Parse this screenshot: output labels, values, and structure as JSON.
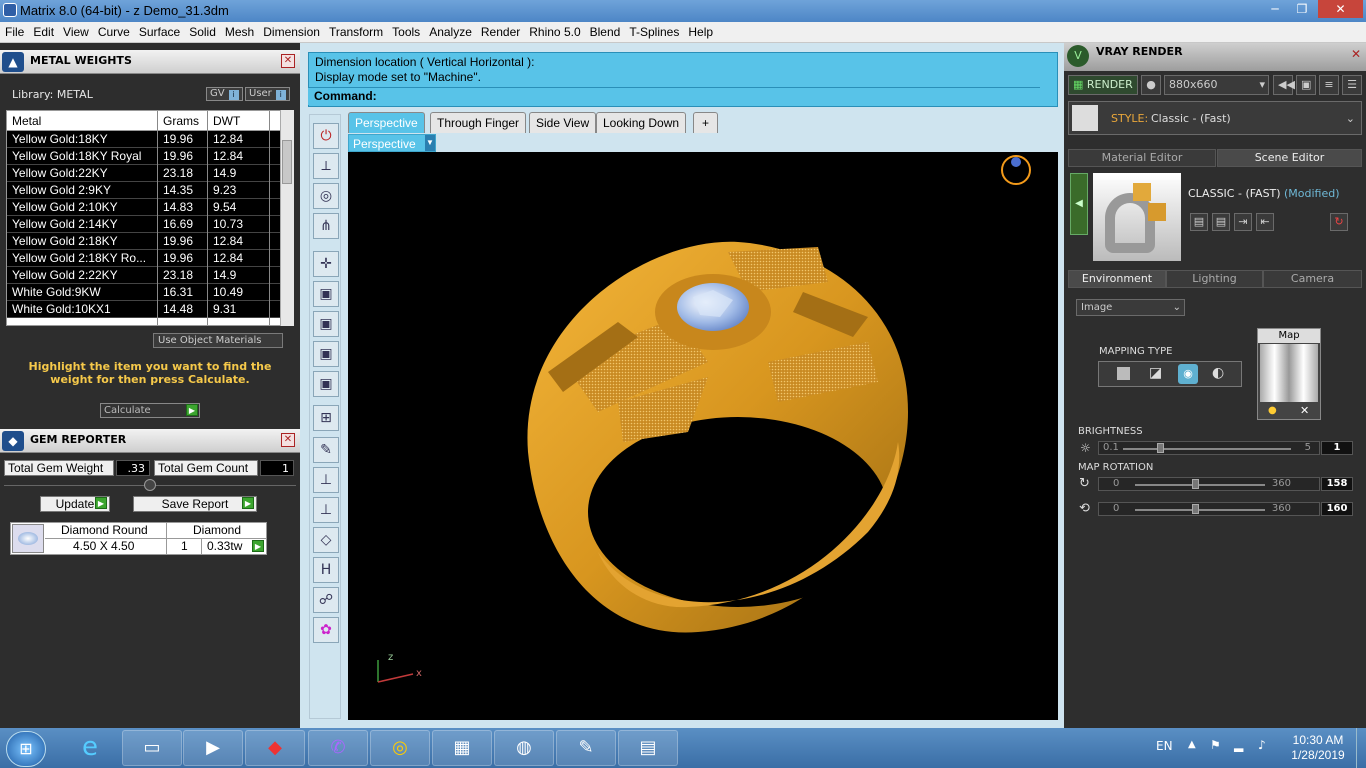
{
  "window": {
    "title": "Matrix 8.0 (64-bit) - z Demo_31.3dm",
    "min": "─",
    "max": "❐",
    "close": "✕"
  },
  "menu": [
    "File",
    "Edit",
    "View",
    "Curve",
    "Surface",
    "Solid",
    "Mesh",
    "Dimension",
    "Transform",
    "Tools",
    "Analyze",
    "Render",
    "Rhino 5.0",
    "Blend",
    "T-Splines",
    "Help"
  ],
  "metal": {
    "title": "METAL WEIGHTS",
    "close": "✕",
    "library": "Library: METAL",
    "gv": "GV",
    "user": "User",
    "headers": [
      "Metal",
      "Grams",
      "DWT"
    ],
    "rows": [
      [
        "Yellow Gold:18KY",
        "19.96",
        "12.84"
      ],
      [
        "Yellow Gold:18KY Royal",
        "19.96",
        "12.84"
      ],
      [
        "Yellow Gold:22KY",
        "23.18",
        "14.9"
      ],
      [
        "Yellow Gold 2:9KY",
        "14.35",
        "9.23"
      ],
      [
        "Yellow Gold 2:10KY",
        "14.83",
        "9.54"
      ],
      [
        "Yellow Gold 2:14KY",
        "16.69",
        "10.73"
      ],
      [
        "Yellow Gold 2:18KY",
        "19.96",
        "12.84"
      ],
      [
        "Yellow Gold 2:18KY Ro...",
        "19.96",
        "12.84"
      ],
      [
        "Yellow Gold 2:22KY",
        "23.18",
        "14.9"
      ],
      [
        "White Gold:9KW",
        "16.31",
        "10.49"
      ],
      [
        "White Gold:10KX1",
        "14.48",
        "9.31"
      ]
    ],
    "use_object": "Use Object Materials",
    "hint": "Highlight the item you want to find the weight for then press Calculate.",
    "calculate": "Calculate"
  },
  "gem": {
    "title": "GEM REPORTER",
    "close": "✕",
    "total_weight_label": "Total Gem Weight",
    "total_weight": ".33",
    "total_count_label": "Total Gem Count",
    "total_count": "1",
    "update": "Update",
    "save": "Save Report",
    "head1": "Diamond Round",
    "head2": "Diamond",
    "size": "4.50 X 4.50",
    "qty": "1",
    "ctw": "0.33tw"
  },
  "command": {
    "line1": "Dimension location ( Vertical  Horizontal ):",
    "line2": "Display mode set to \"Machine\".",
    "prompt": "Command:"
  },
  "tabs": [
    "Perspective",
    "Through Finger",
    "Side View",
    "Looking Down",
    "+"
  ],
  "viewport_label": "Perspective",
  "axes": {
    "z": "z",
    "x": "x"
  },
  "vray": {
    "title": "VRAY RENDER",
    "close": "✕",
    "render": "RENDER",
    "resolution": "880x660",
    "style_label": "STYLE:",
    "style_value": "Classic - (Fast)",
    "tabs": [
      "Material Editor",
      "Scene Editor"
    ],
    "preset": "CLASSIC - (FAST)",
    "modified": "(Modified)",
    "envtabs": [
      "Environment",
      "Lighting",
      "Camera"
    ],
    "image_select": "Image",
    "mapping_type": "MAPPING TYPE",
    "map": "Map",
    "brightness": "BRIGHTNESS",
    "b_min": "0.1",
    "b_max": "5",
    "b_val": "1",
    "b_level": 0.2,
    "map_rotation": "MAP ROTATION",
    "r1_min": "0",
    "r1_max": "360",
    "r1_val": "158",
    "r1_level": 0.44,
    "r2_min": "0",
    "r2_max": "360",
    "r2_val": "160",
    "r2_level": 0.44
  },
  "taskbar": {
    "lang": "EN",
    "time": "10:30 AM",
    "date": "1/28/2019"
  }
}
